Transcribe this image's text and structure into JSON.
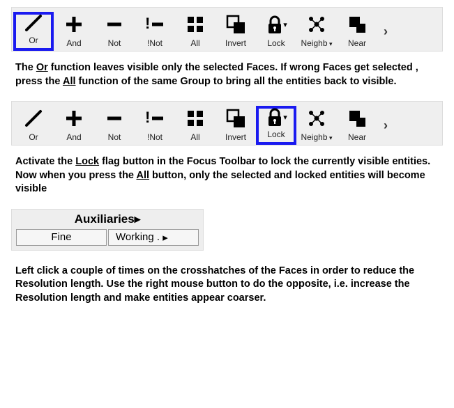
{
  "toolbar1": {
    "items": [
      {
        "label": "Or",
        "icon": "slash",
        "highlight": true
      },
      {
        "label": "And",
        "icon": "plus"
      },
      {
        "label": "Not",
        "icon": "minus"
      },
      {
        "label": "!Not",
        "icon": "bangminus"
      },
      {
        "label": "All",
        "icon": "grid"
      },
      {
        "label": "Invert",
        "icon": "invert"
      },
      {
        "label": "Lock",
        "icon": "lock",
        "dropdown": true
      },
      {
        "label": "Neighb",
        "icon": "neigh",
        "dropdown_below": true
      },
      {
        "label": "Near",
        "icon": "near"
      }
    ]
  },
  "caption1_a": "The ",
  "caption1_or": "Or",
  "caption1_b": " function leaves visible only the selected Faces. If wrong Faces get selected , press the ",
  "caption1_all": "All",
  "caption1_c": " function of the same Group to bring all the entities back to visible.",
  "toolbar2": {
    "items": [
      {
        "label": "Or",
        "icon": "slash"
      },
      {
        "label": "And",
        "icon": "plus"
      },
      {
        "label": "Not",
        "icon": "minus"
      },
      {
        "label": "!Not",
        "icon": "bangminus"
      },
      {
        "label": "All",
        "icon": "grid"
      },
      {
        "label": "Invert",
        "icon": "invert"
      },
      {
        "label": "Lock",
        "icon": "lock",
        "dropdown": true,
        "highlight": true
      },
      {
        "label": "Neighb",
        "icon": "neigh",
        "dropdown_below": true
      },
      {
        "label": "Near",
        "icon": "near"
      }
    ]
  },
  "caption2_a": "Activate the ",
  "caption2_lock": "Lock",
  "caption2_b": " flag button in the Focus Toolbar to lock the currently visible entities.  Now when you press the  ",
  "caption2_all": "All",
  "caption2_c": " button, only the  selected and locked entities will become visible",
  "aux": {
    "title": "Auxiliaries",
    "fine": "Fine",
    "working": "Working ."
  },
  "caption3": "Left click a couple of times on the crosshatches of the Faces in order to reduce the Resolution length. Use the right mouse button to do the opposite, i.e. increase the Resolution length and make entities appear coarser."
}
